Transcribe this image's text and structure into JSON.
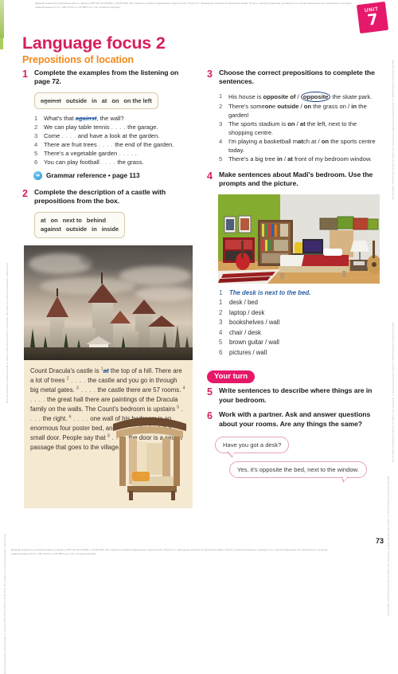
{
  "unit_badge": {
    "word": "UNIT",
    "number": "7",
    "color": "#e6186a"
  },
  "header": {
    "title": "Language focus 2",
    "subtitle": "Prepositions of location",
    "title_color": "#d81e5b",
    "subtitle_color": "#f08a1c"
  },
  "copyright": {
    "top": "Данный экземпляр учебника выдан по запросу МОН РК 013-2/568 от 10.09.2019. Все права на учебник принадлежат издательству \"Study Inc.\" Защищены законом об авторском праве. Печать и распространение учебника и его частей запрещены без письменного согласия правообладателя\" пст. 198 УК РК,ст.1 00 МРП до 3 лет лишения свободы.",
    "bottom": "Данный экземпляр учебника выдан по запросу МОН РК 013-2/568 от 10.09.2019. Все права на учебник принадлежат издательству \"Study Inc.\" защищены законом об авторском праве. Печать и распространение учебника и его частей запрещены без письменного согласия правообладателя\" пст. 198 УК РК,ст.1 00 МРП до 3 лет лишения свободы.",
    "side": "Данный экземпляр учебника выдан по запросу МОН РК 013-2/568 от 10.09.2019. Все права на учебник принадлежат издательству"
  },
  "exercise1": {
    "number": "1",
    "instruction": "Complete the examples from the listening on page 72.",
    "word_box": [
      "against",
      "outside",
      "in",
      "at",
      "on",
      "on the left"
    ],
    "word_box_strike_index": 0,
    "items": [
      {
        "n": "1",
        "pre": "What's that ",
        "answer": "against",
        "post": ", the wall?"
      },
      {
        "n": "2",
        "pre": "We can play table tennis ",
        "answer": "",
        "post": " the garage."
      },
      {
        "n": "3",
        "pre": "Come ",
        "answer": "",
        "post": " and have a look at the garden."
      },
      {
        "n": "4",
        "pre": "There are fruit trees ",
        "answer": "",
        "post": " the end of the garden."
      },
      {
        "n": "5",
        "pre": "There's a vegetable garden ",
        "answer": "",
        "post": " ."
      },
      {
        "n": "6",
        "pre": "You can play football ",
        "answer": "",
        "post": " the grass."
      }
    ],
    "grammar_reference": "Grammar reference • page 113",
    "grammar_icon": "arrow-circle-icon"
  },
  "exercise2": {
    "number": "2",
    "instruction": "Complete the description of a castle with prepositions from the box.",
    "word_box_row1": [
      "at",
      "on",
      "next to",
      "behind"
    ],
    "word_box_row2": [
      "against",
      "outside",
      "in",
      "inside"
    ],
    "photo_caption": "castle-photograph",
    "text_parts": [
      {
        "t": "Count Dracula's castle is "
      },
      {
        "sup": "1"
      },
      {
        "ans": "at"
      },
      {
        "t": " the top of a hill. There are a lot of trees "
      },
      {
        "sup": "2"
      },
      {
        "blank": true
      },
      {
        "t": " the castle and you go in through big metal gates. "
      },
      {
        "sup": "3"
      },
      {
        "blank": true
      },
      {
        "t": " the castle there are 57 rooms. "
      },
      {
        "sup": "4"
      },
      {
        "blank": true
      },
      {
        "t": " the great hall there are paintings of the Dracula family on the walls. The Count's bedroom is upstairs "
      },
      {
        "sup": "5"
      },
      {
        "blank": true
      },
      {
        "t": " the right. "
      },
      {
        "sup": "6"
      },
      {
        "blank": true
      },
      {
        "t": " one wall of his bedroom is an enormous four poster bed, and "
      },
      {
        "sup": "7"
      },
      {
        "blank": true
      },
      {
        "t": " the bed is a small door. People say that "
      },
      {
        "sup": "8"
      },
      {
        "blank": true
      },
      {
        "t": " the door is a secret passage that goes to the village."
      }
    ]
  },
  "exercise3": {
    "number": "3",
    "instruction": "Choose the correct prepositions to complete the sentences.",
    "items": [
      {
        "n": "1",
        "text": "His house is opposite of / opposite the skate park.",
        "bold": [
          "opposite of",
          "opposite"
        ],
        "circled": "opposite"
      },
      {
        "n": "2",
        "text": "There's someone outside / on the grass on / in the garden!",
        "bold": [
          "outside",
          "on",
          "on",
          "in"
        ]
      },
      {
        "n": "3",
        "text": "The sports stadium is on / at the left, next to the shopping centre.",
        "bold": [
          "on",
          "at"
        ]
      },
      {
        "n": "4",
        "text": "I'm playing a basketball match at / on the sports centre today.",
        "bold": [
          "at",
          "on"
        ]
      },
      {
        "n": "5",
        "text": "There's a big tree in / at front of my bedroom window.",
        "bold": [
          "in",
          "at"
        ]
      }
    ]
  },
  "exercise4": {
    "number": "4",
    "instruction": "Make sentences about Madi's bedroom. Use the prompts and the picture.",
    "photo_caption": "bedroom-photograph",
    "example": {
      "n": "1",
      "text": "The desk is next to the bed."
    },
    "prompts": [
      {
        "n": "1",
        "text": "desk / bed"
      },
      {
        "n": "2",
        "text": "laptop / desk"
      },
      {
        "n": "3",
        "text": "bookshelves / wall"
      },
      {
        "n": "4",
        "text": "chair / desk"
      },
      {
        "n": "5",
        "text": "brown guitar / wall"
      },
      {
        "n": "6",
        "text": "pictures / wall"
      }
    ]
  },
  "your_turn": {
    "label": "Your turn",
    "color": "#e6186a"
  },
  "exercise5": {
    "number": "5",
    "instruction": "Write sentences to describe where things are in your bedroom."
  },
  "exercise6": {
    "number": "6",
    "instruction": "Work with a partner. Ask and answer questions about your rooms. Are any things the same?",
    "bubbles": [
      {
        "text": "Have you got a desk?"
      },
      {
        "text": "Yes, it's opposite the bed, next to the window."
      }
    ]
  },
  "page_number": "73"
}
